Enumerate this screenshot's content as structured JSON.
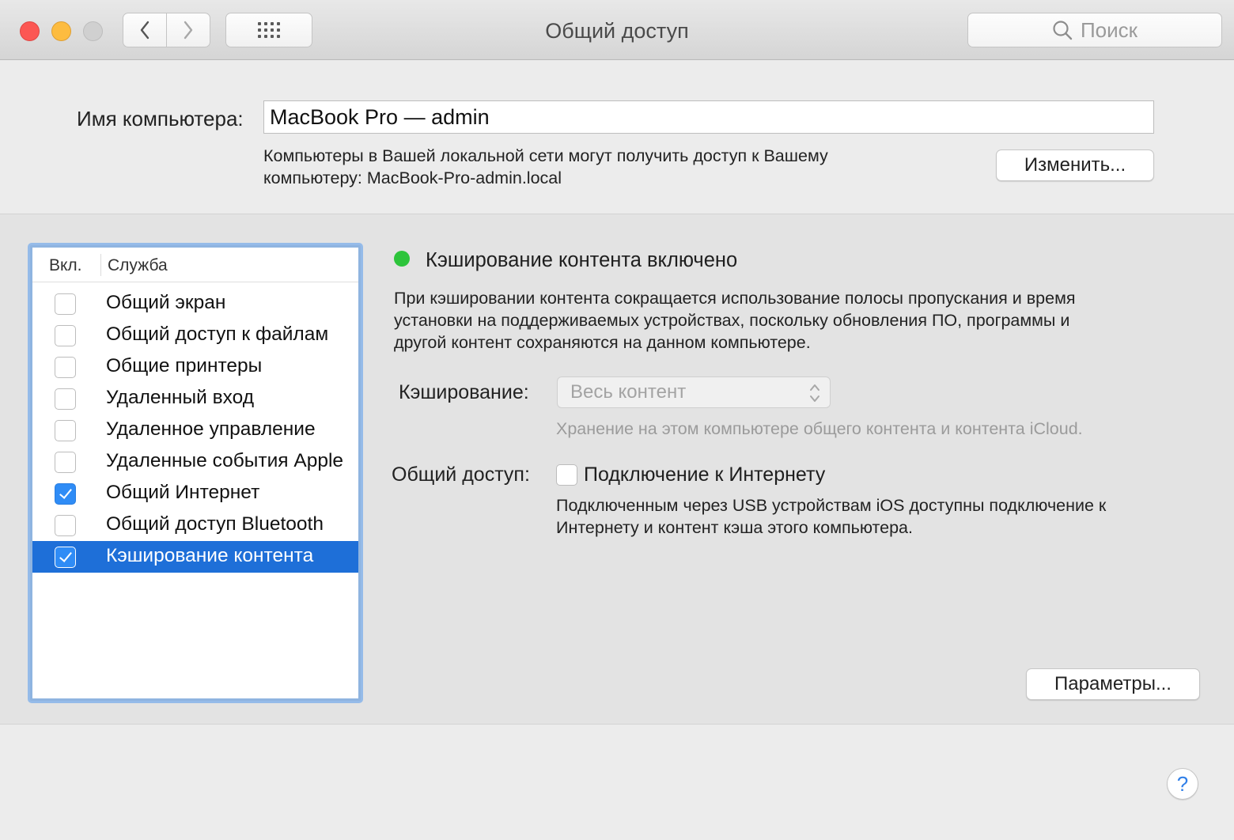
{
  "window": {
    "title": "Общий доступ",
    "search_placeholder": "Поиск"
  },
  "computer_name": {
    "label": "Имя компьютера:",
    "value": "MacBook Pro — admin",
    "description_line1": "Компьютеры в Вашей локальной сети могут получить доступ к Вашему",
    "description_line2": "компьютеру: MacBook-Pro-admin.local",
    "change_button": "Изменить..."
  },
  "services": {
    "header_on": "Вкл.",
    "header_service": "Служба",
    "items": [
      {
        "label": "Общий экран",
        "checked": false,
        "selected": false
      },
      {
        "label": "Общий доступ к файлам",
        "checked": false,
        "selected": false
      },
      {
        "label": "Общие принтеры",
        "checked": false,
        "selected": false
      },
      {
        "label": "Удаленный вход",
        "checked": false,
        "selected": false
      },
      {
        "label": "Удаленное управление",
        "checked": false,
        "selected": false
      },
      {
        "label": "Удаленные события Apple",
        "checked": false,
        "selected": false
      },
      {
        "label": "Общий Интернет",
        "checked": true,
        "selected": false
      },
      {
        "label": "Общий доступ Bluetooth",
        "checked": false,
        "selected": false
      },
      {
        "label": "Кэширование контента",
        "checked": true,
        "selected": true
      }
    ]
  },
  "detail": {
    "status_title": "Кэширование контента включено",
    "status_color": "#2dc43b",
    "description_line1": "При кэшировании контента сокращается использование полосы пропускания и время",
    "description_line2": "установки на поддерживаемых устройствах, поскольку обновления ПО, программы и",
    "description_line3": "другой контент сохраняются на данном компьютере.",
    "cache_label": "Кэширование:",
    "cache_value": "Весь контент",
    "cache_hint": "Хранение на этом компьютере общего контента и контента iCloud.",
    "share_label": "Общий доступ:",
    "share_checkbox_label": "Подключение к Интернету",
    "share_checked": false,
    "share_desc_line1": "Подключенным через USB устройствам iOS доступны подключение к",
    "share_desc_line2": "Интернету и контент кэша этого компьютера.",
    "params_button": "Параметры...",
    "help_label": "?"
  }
}
